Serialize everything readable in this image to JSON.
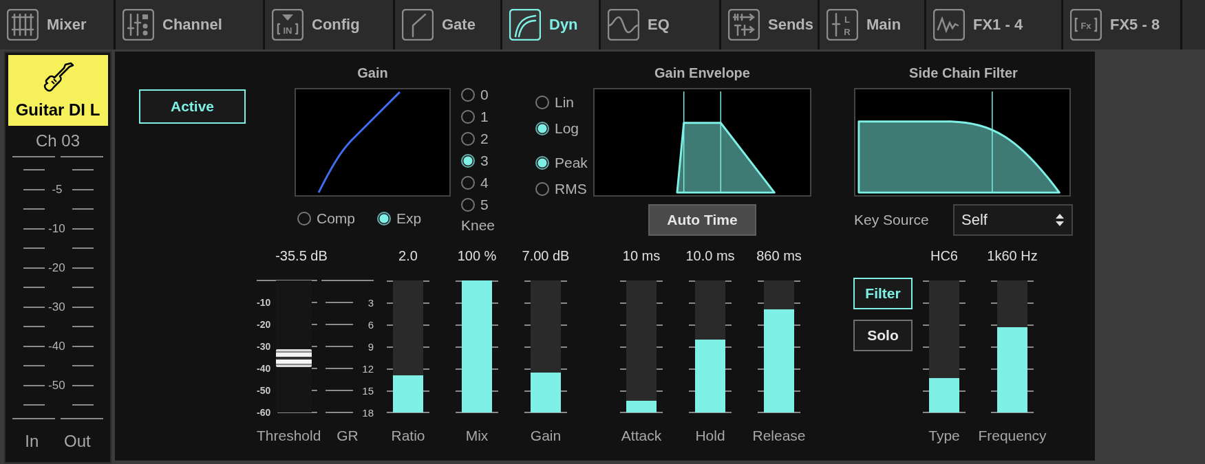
{
  "tabs": [
    {
      "label": "Mixer",
      "kind": "mixer",
      "selected": false
    },
    {
      "label": "Channel",
      "kind": "channel",
      "selected": false
    },
    {
      "label": "Config",
      "kind": "config",
      "icon_text": [
        "IN"
      ],
      "selected": false
    },
    {
      "label": "Gate",
      "kind": "gate",
      "selected": false
    },
    {
      "label": "Dyn",
      "kind": "dyn",
      "selected": true
    },
    {
      "label": "EQ",
      "kind": "eq",
      "selected": false
    },
    {
      "label": "Sends",
      "kind": "sends",
      "selected": false
    },
    {
      "label": "Main",
      "kind": "main",
      "icon_text": [
        "L",
        "R"
      ],
      "selected": false
    },
    {
      "label": "FX1 - 4",
      "kind": "wave",
      "selected": false
    },
    {
      "label": "FX5 - 8",
      "kind": "rack",
      "icon_text": [
        "Fx"
      ],
      "selected": false
    }
  ],
  "channel": {
    "name": "Guitar DI L",
    "number": "Ch 03",
    "scale_labels": [
      "-5",
      "-10",
      "-20",
      "-30",
      "-40",
      "-50"
    ],
    "meters": [
      "In",
      "Out"
    ]
  },
  "active_button": {
    "label": "Active",
    "on": true
  },
  "gain": {
    "title": "Gain",
    "modes": [
      {
        "label": "Comp",
        "selected": false
      },
      {
        "label": "Exp",
        "selected": true
      }
    ]
  },
  "knee": {
    "label": "Knee",
    "options": [
      {
        "label": "0",
        "selected": false
      },
      {
        "label": "1",
        "selected": false
      },
      {
        "label": "2",
        "selected": false
      },
      {
        "label": "3",
        "selected": true
      },
      {
        "label": "4",
        "selected": false
      },
      {
        "label": "5",
        "selected": false
      }
    ]
  },
  "envelope_scale": [
    {
      "label": "Lin",
      "selected": false
    },
    {
      "label": "Log",
      "selected": true
    }
  ],
  "detector": [
    {
      "label": "Peak",
      "selected": true
    },
    {
      "label": "RMS",
      "selected": false
    }
  ],
  "envelope": {
    "title": "Gain Envelope",
    "auto_time": "Auto Time"
  },
  "side_chain": {
    "title": "Side Chain Filter",
    "key_source": {
      "label": "Key Source",
      "value": "Self"
    },
    "filter": {
      "label": "Filter",
      "on": true
    },
    "solo": {
      "label": "Solo",
      "on": false
    }
  },
  "threshold": {
    "value": "-35.5 dB",
    "label": "Threshold",
    "level": 0.41,
    "scale_labels": [
      "-10",
      "-20",
      "-30",
      "-40",
      "-50",
      "-60"
    ]
  },
  "gr": {
    "label": "GR",
    "scale_labels": [
      "3",
      "6",
      "9",
      "12",
      "15",
      "18"
    ]
  },
  "dyn_faders": [
    {
      "label": "Ratio",
      "value": "2.0",
      "level": 0.28
    },
    {
      "label": "Mix",
      "value": "100 %",
      "level": 1.0
    },
    {
      "label": "Gain",
      "value": "7.00 dB",
      "level": 0.3
    }
  ],
  "time_faders": [
    {
      "label": "Attack",
      "value": "10 ms",
      "level": 0.09
    },
    {
      "label": "Hold",
      "value": "10.0 ms",
      "level": 0.55
    },
    {
      "label": "Release",
      "value": "860 ms",
      "level": 0.78
    }
  ],
  "filter_faders": [
    {
      "label": "Type",
      "value": "HC6",
      "level": 0.26
    },
    {
      "label": "Frequency",
      "value": "1k60 Hz",
      "level": 0.645
    }
  ]
}
